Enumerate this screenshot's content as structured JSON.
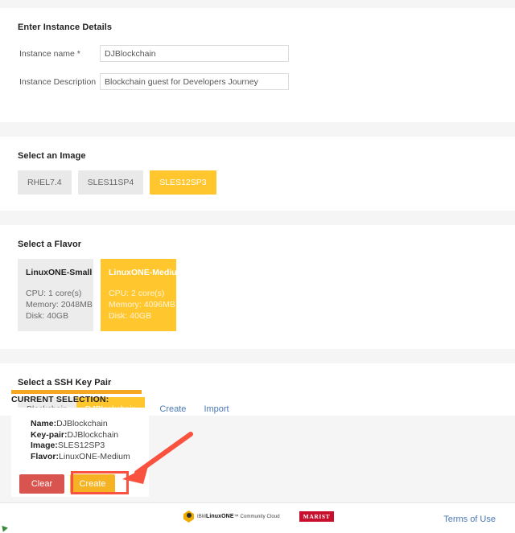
{
  "sections": {
    "instance_details": {
      "title": "Enter Instance Details",
      "fields": [
        {
          "label": "Instance name *",
          "value": "DJBlockchain",
          "placeholder": ""
        },
        {
          "label": "Instance Description",
          "value": "Blockchain guest for Developers Journey",
          "placeholder": ""
        }
      ]
    },
    "image": {
      "title": "Select an Image",
      "options": [
        {
          "label": "RHEL7.4",
          "selected": false
        },
        {
          "label": "SLES11SP4",
          "selected": false
        },
        {
          "label": "SLES12SP3",
          "selected": true
        }
      ]
    },
    "flavor": {
      "title": "Select a Flavor",
      "options": [
        {
          "name": "LinuxONE-Small",
          "cpu": "CPU: 1 core(s)",
          "memory": "Memory: 2048MB",
          "disk": "Disk: 40GB",
          "selected": false
        },
        {
          "name": "LinuxONE-Medium",
          "cpu": "CPU: 2 core(s)",
          "memory": "Memory: 4096MB",
          "disk": "Disk: 40GB",
          "selected": true
        }
      ]
    },
    "ssh": {
      "title": "Select a SSH Key Pair",
      "keys": [
        {
          "label": "Blockchain",
          "selected": false
        },
        {
          "label": "DJBlockchain",
          "selected": true
        }
      ],
      "create_link": "Create",
      "import_link": "Import"
    }
  },
  "current_selection": {
    "title": "CURRENT SELECTION:",
    "items": [
      {
        "key": "Name:",
        "value": "DJBlockchain"
      },
      {
        "key": "Key-pair:",
        "value": "DJBlockchain"
      },
      {
        "key": "Image:",
        "value": "SLES12SP3"
      },
      {
        "key": "Flavor:",
        "value": "LinuxONE-Medium"
      }
    ],
    "clear_label": "Clear",
    "create_label": "Create"
  },
  "footer": {
    "ibm_prefix": "IBM",
    "ibm_brand": "LinuxONE",
    "ibm_suffix": "™ Community Cloud",
    "marist": "MARIST",
    "terms": "Terms of Use"
  },
  "colors": {
    "accent_yellow": "#ffc62e",
    "selection_bar": "#f5a623",
    "clear_red": "#d9534f",
    "create_yellow": "#f5b324",
    "annotation_red": "#f9533f",
    "link_blue": "#4a77b5",
    "marist_red": "#c8102e",
    "band_grey": "#f5f5f5"
  }
}
